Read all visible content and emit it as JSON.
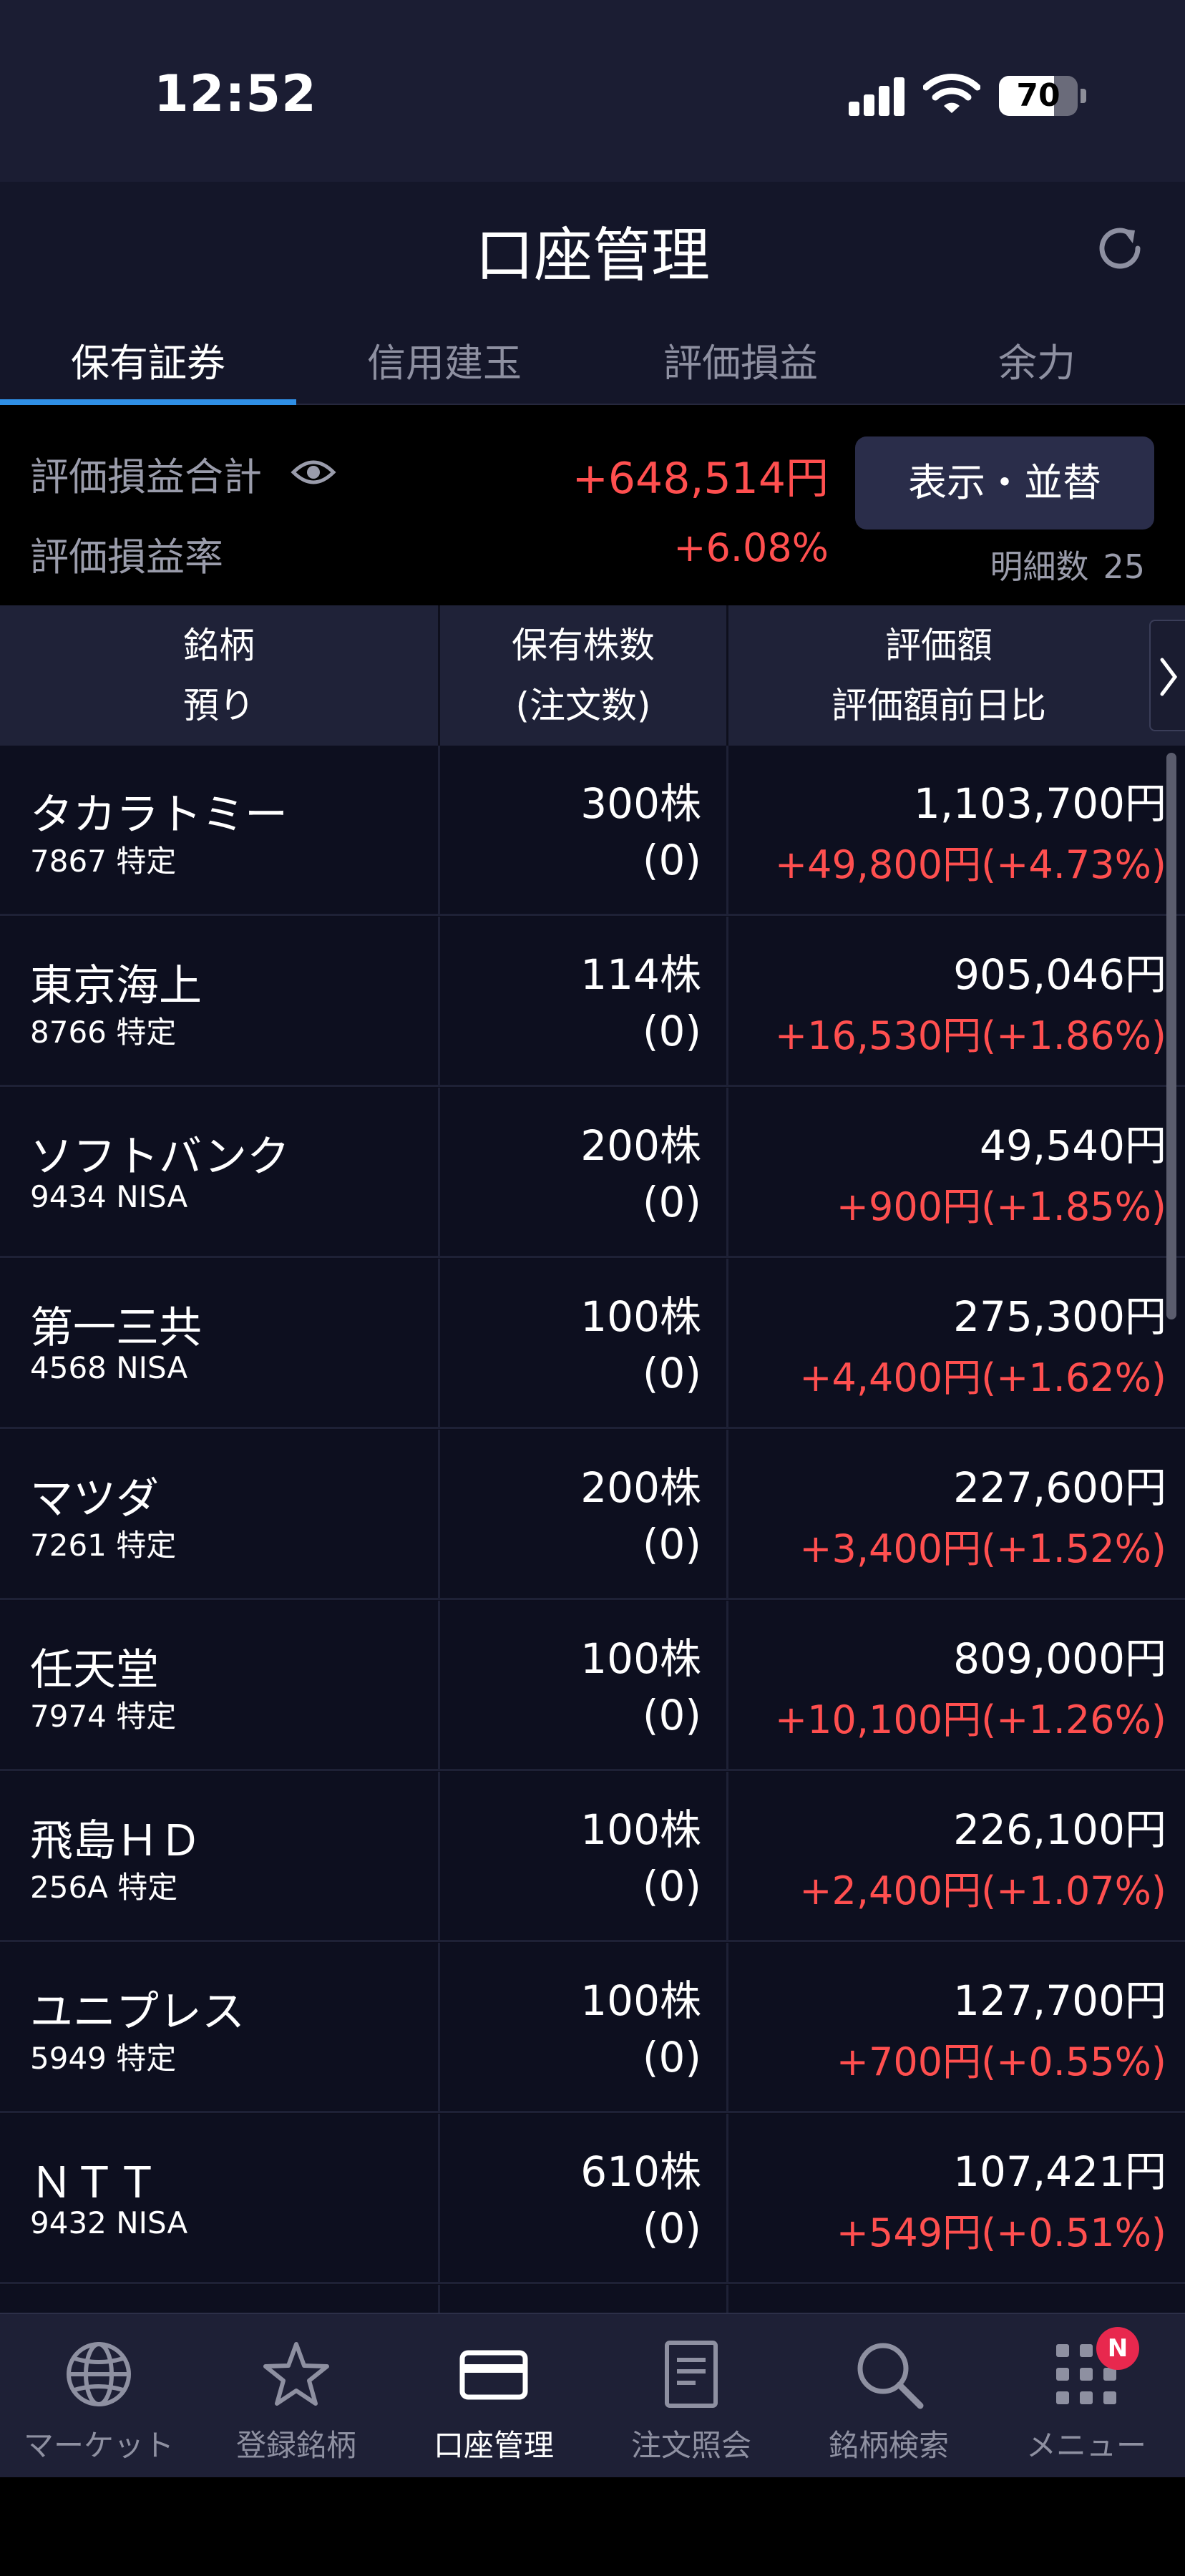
{
  "status_bar": {
    "time": "12:52",
    "battery": "70",
    "battery_level": 0.7
  },
  "header": {
    "title": "口座管理"
  },
  "tabs": [
    {
      "label": "保有証券",
      "active": true
    },
    {
      "label": "信用建玉",
      "active": false
    },
    {
      "label": "評価損益",
      "active": false
    },
    {
      "label": "余力",
      "active": false
    }
  ],
  "summary": {
    "total_label": "評価損益合計",
    "total_value": "+648,514円",
    "rate_label": "評価損益率",
    "rate_value": "+6.08%",
    "sort_button": "表示・並替",
    "count_label": "明細数",
    "count_value": "25"
  },
  "columns": {
    "col1_line1": "銘柄",
    "col1_line2": "預り",
    "col2_line1": "保有株数",
    "col2_line2": "(注文数)",
    "col3_line1": "評価額",
    "col3_line2": "評価額前日比"
  },
  "holdings": [
    {
      "name": "タカラトミー",
      "code": "7867 特定",
      "shares": "300株",
      "orders": "(0)",
      "value": "1,103,700円",
      "change": "+49,800円(+4.73%)"
    },
    {
      "name": "東京海上",
      "code": "8766 特定",
      "shares": "114株",
      "orders": "(0)",
      "value": "905,046円",
      "change": "+16,530円(+1.86%)"
    },
    {
      "name": "ソフトバンク",
      "code": "9434 NISA",
      "shares": "200株",
      "orders": "(0)",
      "value": "49,540円",
      "change": "+900円(+1.85%)"
    },
    {
      "name": "第一三共",
      "code": "4568 NISA",
      "shares": "100株",
      "orders": "(0)",
      "value": "275,300円",
      "change": "+4,400円(+1.62%)"
    },
    {
      "name": "マツダ",
      "code": "7261 特定",
      "shares": "200株",
      "orders": "(0)",
      "value": "227,600円",
      "change": "+3,400円(+1.52%)"
    },
    {
      "name": "任天堂",
      "code": "7974 特定",
      "shares": "100株",
      "orders": "(0)",
      "value": "809,000円",
      "change": "+10,100円(+1.26%)"
    },
    {
      "name": "飛島ＨＤ",
      "code": "256A 特定",
      "shares": "100株",
      "orders": "(0)",
      "value": "226,100円",
      "change": "+2,400円(+1.07%)"
    },
    {
      "name": "ユニプレス",
      "code": "5949 特定",
      "shares": "100株",
      "orders": "(0)",
      "value": "127,700円",
      "change": "+700円(+0.55%)"
    },
    {
      "name": "ＮＴＴ",
      "code": "9432 NISA",
      "shares": "610株",
      "orders": "(0)",
      "value": "107,421円",
      "change": "+549円(+0.51%)"
    }
  ],
  "bottom_nav": [
    {
      "label": "マーケット",
      "icon": "globe-icon",
      "active": false
    },
    {
      "label": "登録銘柄",
      "icon": "star-icon",
      "active": false
    },
    {
      "label": "口座管理",
      "icon": "card-icon",
      "active": true
    },
    {
      "label": "注文照会",
      "icon": "document-icon",
      "active": false
    },
    {
      "label": "銘柄検索",
      "icon": "search-icon",
      "active": false
    },
    {
      "label": "メニュー",
      "icon": "grid-icon",
      "active": false,
      "badge": "N"
    }
  ],
  "colors": {
    "positive": "#ff4f4f",
    "accent": "#2f8fe6",
    "badge": "#e8284e"
  }
}
